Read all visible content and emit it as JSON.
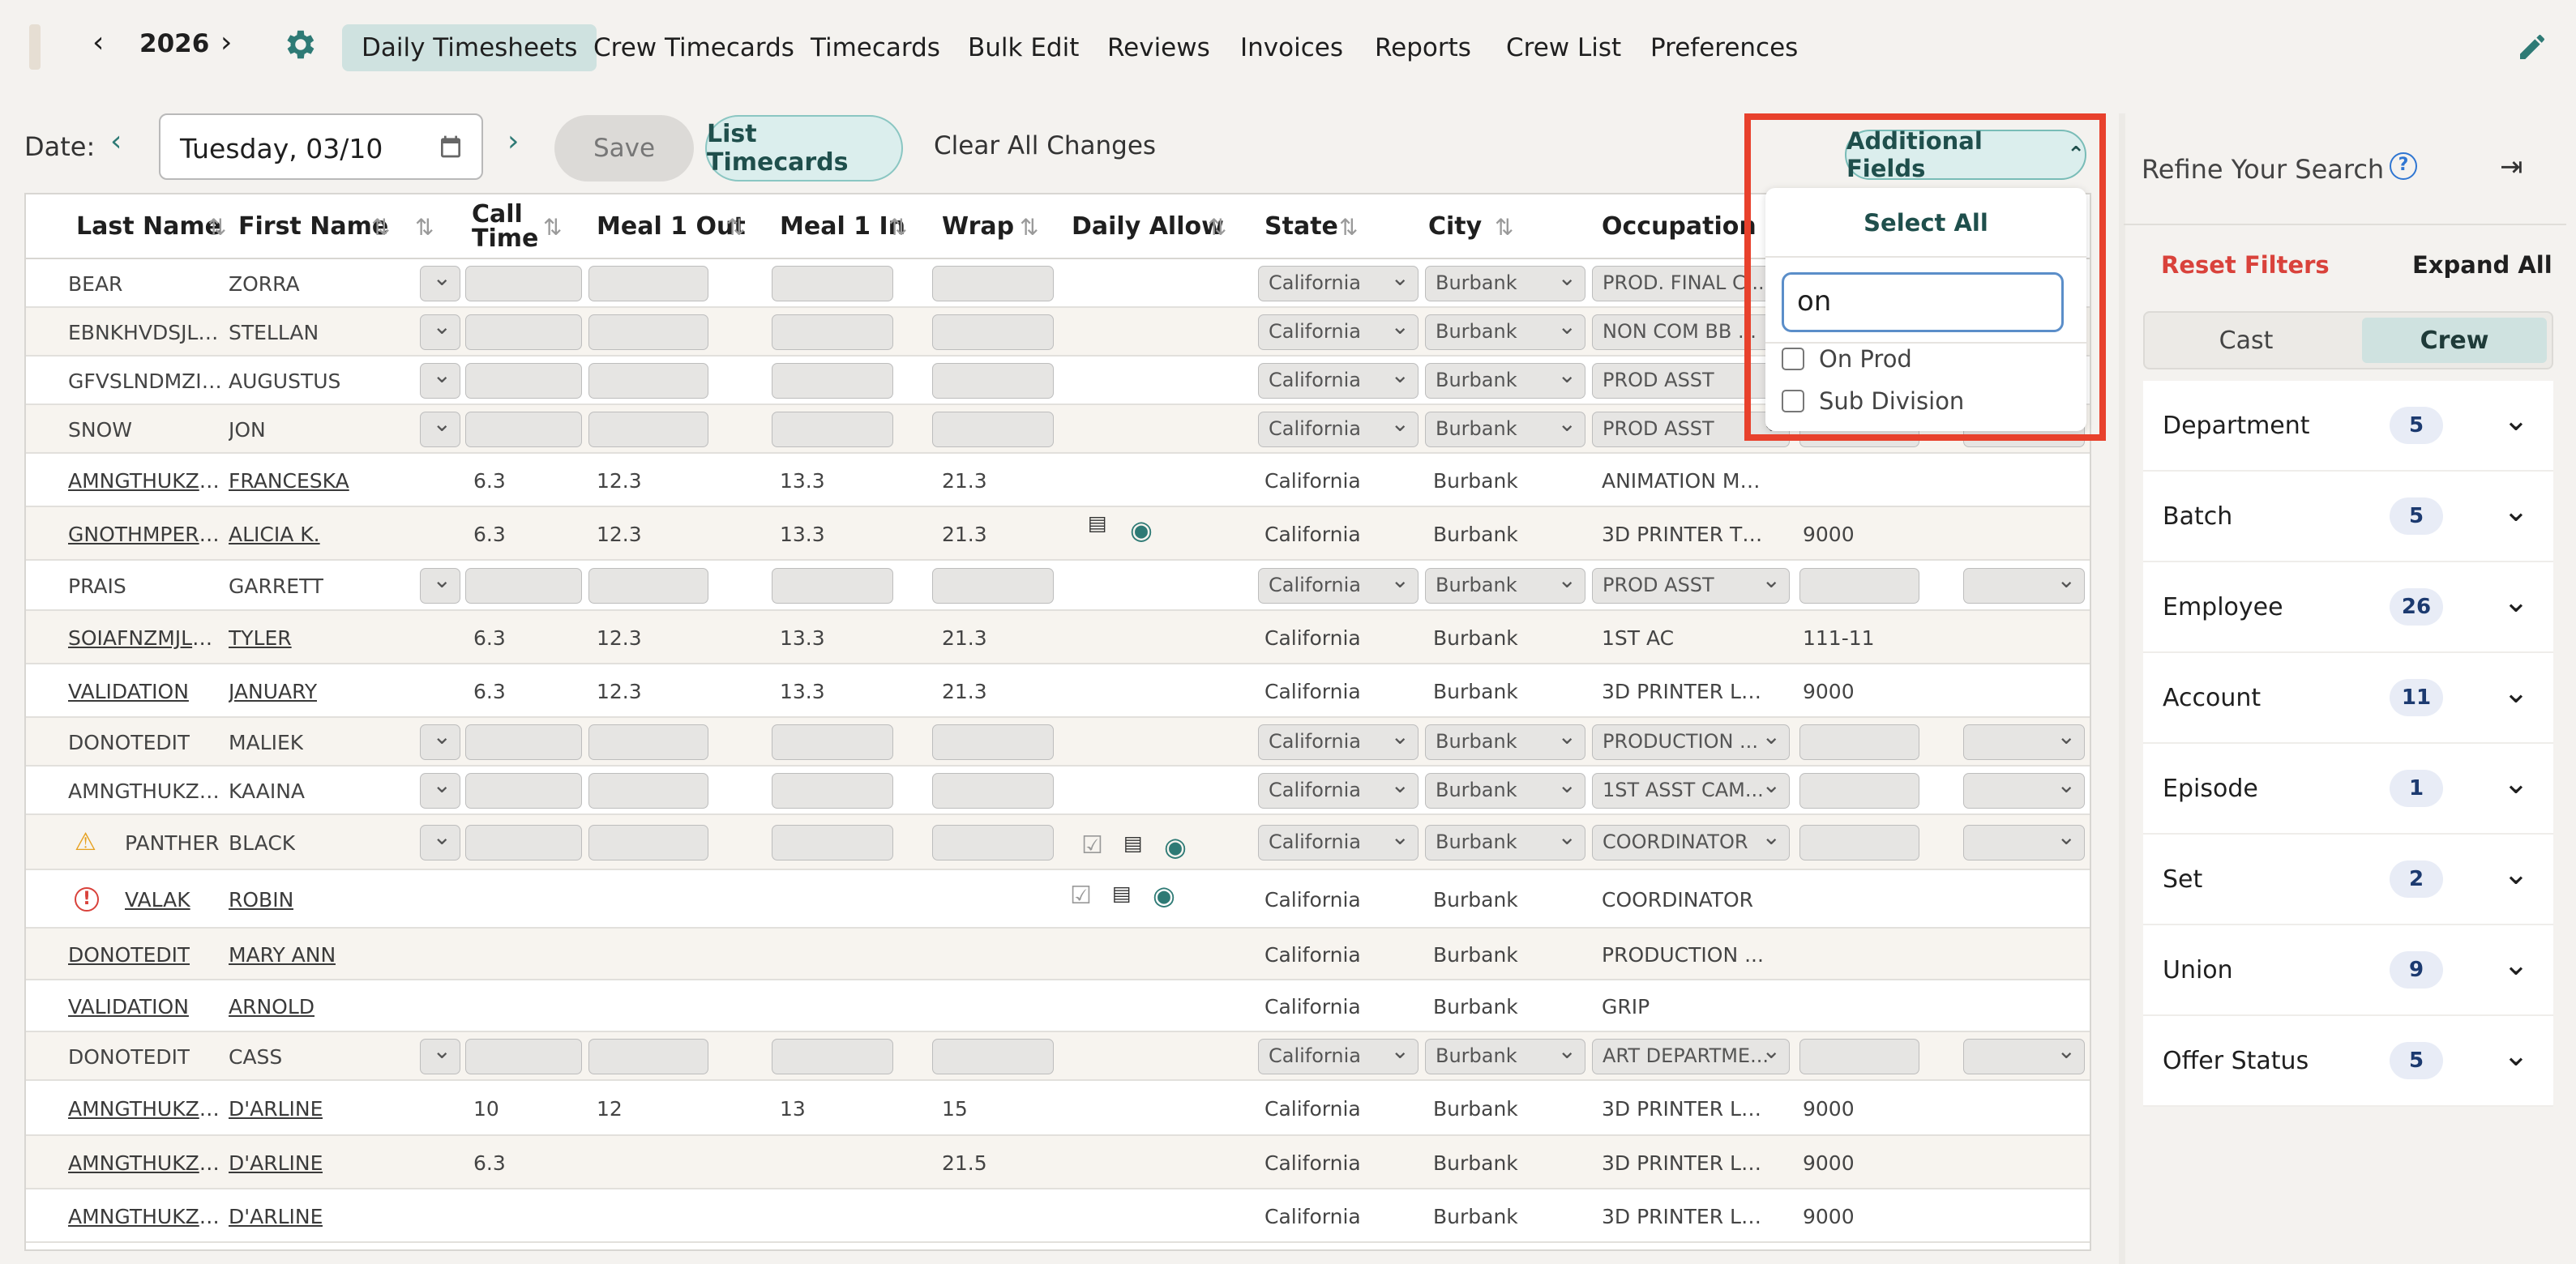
{
  "nav": {
    "year": "2026",
    "tabs": [
      "Daily Timesheets",
      "Crew Timecards",
      "Timecards",
      "Bulk Edit",
      "Reviews",
      "Invoices",
      "Reports",
      "Crew List",
      "Preferences"
    ],
    "active_tab": "Daily Timesheets"
  },
  "toolbar": {
    "date_label": "Date:",
    "date_value": "Tuesday, 03/10",
    "save_label": "Save",
    "list_label": "List Timecards",
    "clear_label": "Clear All Changes",
    "additional_fields_label": "Additional Fields"
  },
  "dropdown": {
    "select_all": "Select All",
    "search_value": "on",
    "options": [
      "On Prod",
      "Sub Division"
    ]
  },
  "table": {
    "headers": [
      "Last Name",
      "First Name",
      "Call Time",
      "Meal 1 Out",
      "Meal 1 In",
      "Wrap",
      "Daily Allow",
      "State",
      "City",
      "Occupation"
    ],
    "rows": [
      {
        "last": "BEAR",
        "first": "ZORRA",
        "edit": true,
        "occ": "PROD. FINAL C..."
      },
      {
        "last": "EBNKHVDSJLR...",
        "first": "STELLAN",
        "edit": true,
        "occ": "NON COM BB ..."
      },
      {
        "last": "GFVSLNDMZIET...",
        "first": "AUGUSTUS",
        "edit": true,
        "occ": "PROD ASST"
      },
      {
        "last": "SNOW",
        "first": "JON",
        "edit": true,
        "occ": "PROD ASST"
      },
      {
        "last": "AMNGTHUKZRP...",
        "first": "FRANCESKA",
        "edit": false,
        "call": "6.3",
        "m1o": "12.3",
        "m1i": "13.3",
        "wrap": "21.3",
        "state": "California",
        "city": "Burbank",
        "occ": "ANIMATION MA...",
        "extra": ""
      },
      {
        "last": "GNOTHMPERZ...",
        "first": "ALICIA K.",
        "edit": false,
        "call": "6.3",
        "m1o": "12.3",
        "m1i": "13.3",
        "wrap": "21.3",
        "state": "California",
        "city": "Burbank",
        "occ": "3D PRINTER TEC...",
        "extra": "9000"
      },
      {
        "last": "PRAIS",
        "first": "GARRETT",
        "edit": true,
        "occ": "PROD ASST"
      },
      {
        "last": "SOIAFNZMJLHV...",
        "first": "TYLER",
        "edit": false,
        "call": "6.3",
        "m1o": "12.3",
        "m1i": "13.3",
        "wrap": "21.3",
        "state": "California",
        "city": "Burbank",
        "occ": "1ST AC",
        "extra": "111-11"
      },
      {
        "last": "VALIDATION",
        "first": "JANUARY",
        "edit": false,
        "call": "6.3",
        "m1o": "12.3",
        "m1i": "13.3",
        "wrap": "21.3",
        "state": "California",
        "city": "Burbank",
        "occ": "3D PRINTER LEAD",
        "extra": "9000"
      },
      {
        "last": "DONOTEDIT",
        "first": "MALIEK",
        "edit": true,
        "occ": "PRODUCTION ..."
      },
      {
        "last": "AMNGTHUKZRP...",
        "first": "KAAINA",
        "edit": true,
        "occ": "1ST ASST CAM..."
      },
      {
        "last": "PANTHER",
        "first": "BLACK",
        "edit": true,
        "occ": "COORDINATOR"
      },
      {
        "last": "VALAK",
        "first": "ROBIN",
        "edit": false,
        "state": "California",
        "city": "Burbank",
        "occ": "COORDINATOR",
        "extra": ""
      },
      {
        "last": "DONOTEDIT",
        "first": "MARY ANN",
        "edit": false,
        "state": "California",
        "city": "Burbank",
        "occ": "PRODUCTION ...",
        "extra": ""
      },
      {
        "last": "VALIDATION",
        "first": "ARNOLD",
        "edit": false,
        "state": "California",
        "city": "Burbank",
        "occ": "GRIP",
        "extra": ""
      },
      {
        "last": "DONOTEDIT",
        "first": "CASS",
        "edit": true,
        "occ": "ART DEPARTME..."
      },
      {
        "last": "AMNGTHUKZRP...",
        "first": "D'ARLINE",
        "edit": false,
        "call": "10",
        "m1o": "12",
        "m1i": "13",
        "wrap": "15",
        "state": "California",
        "city": "Burbank",
        "occ": "3D PRINTER LEAD",
        "extra": "9000"
      },
      {
        "last": "AMNGTHUKZRP...",
        "first": "D'ARLINE",
        "edit": false,
        "call": "6.3",
        "m1o": "",
        "m1i": "",
        "wrap": "21.5",
        "state": "California",
        "city": "Burbank",
        "occ": "3D PRINTER LEAD",
        "extra": "9000"
      },
      {
        "last": "AMNGTHUKZRP...",
        "first": "D'ARLINE",
        "edit": false,
        "call": "",
        "m1o": "",
        "m1i": "",
        "wrap": "",
        "state": "California",
        "city": "Burbank",
        "occ": "3D PRINTER LEAD",
        "extra": "9000"
      }
    ],
    "select_state": "California",
    "select_city": "Burbank"
  },
  "panel": {
    "title": "Refine Your Search",
    "reset": "Reset Filters",
    "expand": "Expand All",
    "segments": [
      "Cast",
      "Crew"
    ],
    "active_segment": "Crew",
    "facets": [
      {
        "label": "Department",
        "count": "5"
      },
      {
        "label": "Batch",
        "count": "5"
      },
      {
        "label": "Employee",
        "count": "26"
      },
      {
        "label": "Account",
        "count": "11"
      },
      {
        "label": "Episode",
        "count": "1"
      },
      {
        "label": "Set",
        "count": "2"
      },
      {
        "label": "Union",
        "count": "9"
      },
      {
        "label": "Offer Status",
        "count": "5"
      }
    ]
  },
  "colors": {
    "accent": "#2e7a75",
    "highlight": "#e8412c",
    "reset": "#d9423b"
  }
}
